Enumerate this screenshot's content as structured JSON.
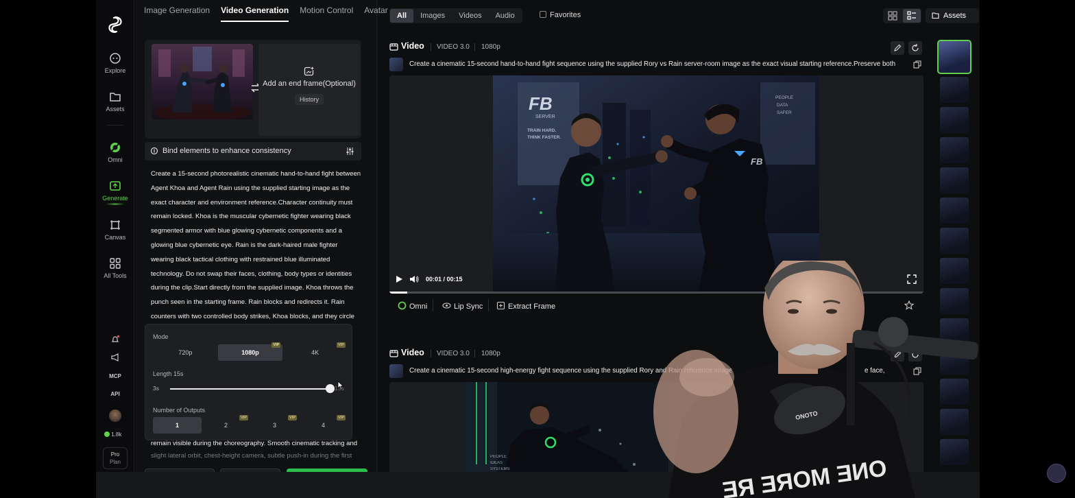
{
  "nav": {
    "items": [
      {
        "label": "Explore",
        "icon": "explore-icon"
      },
      {
        "label": "Assets",
        "icon": "folder-icon"
      },
      {
        "label": "Omni",
        "icon": "omni-icon"
      },
      {
        "label": "Generate",
        "icon": "generate-icon"
      },
      {
        "label": "Canvas",
        "icon": "canvas-icon"
      },
      {
        "label": "All Tools",
        "icon": "grid-icon"
      }
    ],
    "mcp": "MCP",
    "api": "API",
    "credits": "1.8k",
    "plan_title": "Pro",
    "plan_sub": "Plan"
  },
  "panel": {
    "tabs": [
      "Image Generation",
      "Video Generation",
      "Motion Control",
      "Avatar"
    ],
    "end_frame_label": "Add an end frame(Optional)",
    "history_label": "History",
    "bind_label": "Bind elements to enhance consistency",
    "prompt": "Create a 15-second photorealistic cinematic hand-to-hand fight between Agent Khoa and Agent Rain using the supplied starting image as the exact character and environment reference.Character continuity must remain locked. Khoa is the muscular cybernetic fighter wearing black segmented armor with blue glowing cybernetic components and a glowing blue cybernetic eye. Rain is the dark-haired male fighter wearing black tactical clothing with restrained blue illuminated technology. Do not swap their faces, clothing, body types or identities during the clip.Start directly from the supplied image. Khoa throws the punch seen in the starting frame. Rain blocks and redirects it. Rain counters with two controlled body strikes, Khoa blocks, and they circle",
    "prompt_tail": "remain visible during the choreography. Smooth cinematic tracking and",
    "prompt_tail2": "slight lateral orbit, chest-height camera, subtle push-in during the first",
    "settings": {
      "mode_label": "Mode",
      "modes": [
        "720p",
        "1080p",
        "4K"
      ],
      "mode_selected": "1080p",
      "length_label": "Length 15s",
      "length_min": "3s",
      "length_max": "15s",
      "length_value": 15,
      "outputs_label": "Number of Outputs",
      "outputs": [
        "1",
        "2",
        "3",
        "4"
      ],
      "outputs_selected": "1",
      "vip_badge": "VIP"
    }
  },
  "toolbar": {
    "filters": [
      "All",
      "Images",
      "Videos",
      "Audio"
    ],
    "filter_selected": "All",
    "favorites_label": "Favorites",
    "assets_label": "Assets"
  },
  "cards": [
    {
      "title": "Video",
      "model": "VIDEO 3.0",
      "resolution": "1080p",
      "prompt": "Create a cinematic 15-second hand-to-hand fight sequence using the supplied Rory vs Rain server-room image as the exact visual starting reference.Preserve both",
      "time": "00:01 / 00:15",
      "progress": 0.034,
      "actions": [
        "Omni",
        "Lip Sync",
        "Extract Frame"
      ],
      "frame_text": [
        "FB",
        "SERVER",
        "TRAIN HARD.",
        "THINK FASTER.",
        "PEOPLE",
        "DATA",
        "SAFER",
        "FB"
      ]
    },
    {
      "title": "Video",
      "model": "VIDEO 3.0",
      "resolution": "1080p",
      "prompt": "Create a cinematic 15-second high-energy fight sequence using the supplied Rory and Rain reference images.",
      "prompt_end": "e face,",
      "frame_text": [
        "PEOPLE",
        "IDEAS",
        "SYSTEMS"
      ]
    }
  ],
  "webcam": {
    "shirt_text": "ONE MORE RE",
    "mic_brand": "ONOTO"
  },
  "colors": {
    "accent": "#5fd14a",
    "background": "#0d0e10",
    "panel": "#1a1b1e"
  }
}
